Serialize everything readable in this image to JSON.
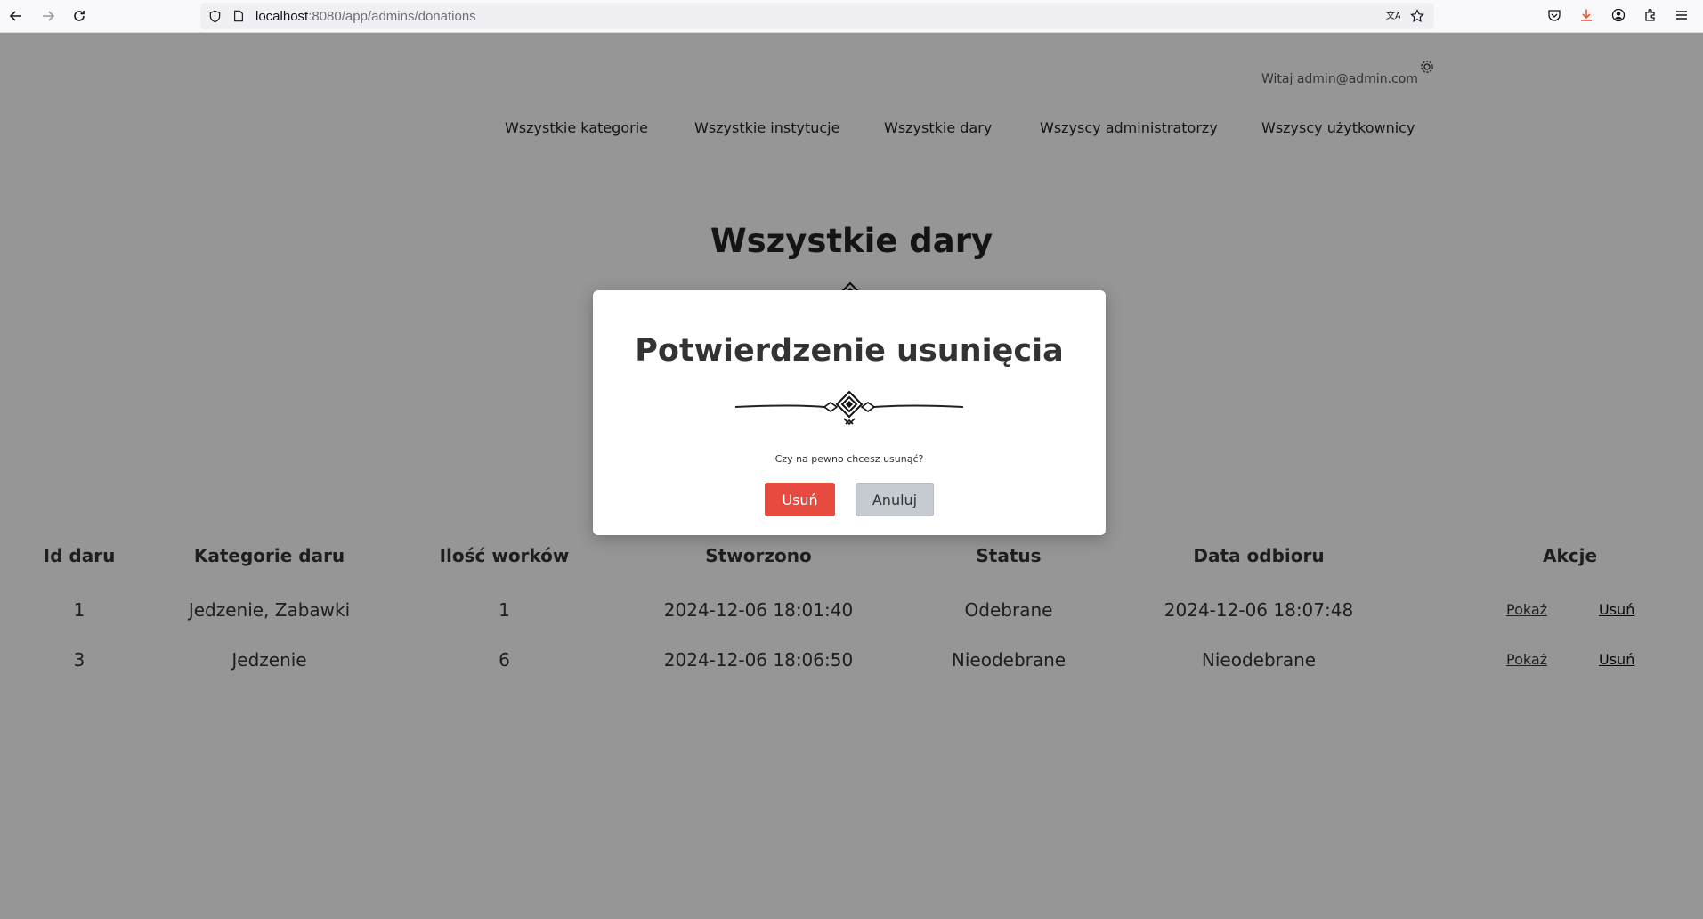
{
  "browser": {
    "url_host": "localhost",
    "url_path": ":8080/app/admins/donations"
  },
  "header": {
    "greeting": "Witaj admin@admin.com",
    "nav": [
      "Wszystkie kategorie",
      "Wszystkie instytucje",
      "Wszystkie dary",
      "Wszyscy administratorzy",
      "Wszyscy użytkownicy"
    ]
  },
  "main": {
    "title": "Wszystkie dary",
    "table": {
      "headers": [
        "Id daru",
        "Kategorie daru",
        "Ilość worków",
        "Stworzono",
        "Status",
        "Data odbioru",
        "Akcje"
      ],
      "rows": [
        {
          "id": "1",
          "categories": "Jedzenie, Zabawki",
          "bags": "1",
          "created": "2024-12-06 18:01:40",
          "status": "Odebrane",
          "pickup": "2024-12-06 18:07:48",
          "show": "Pokaż",
          "delete": "Usuń"
        },
        {
          "id": "3",
          "categories": "Jedzenie",
          "bags": "6",
          "created": "2024-12-06 18:06:50",
          "status": "Nieodebrane",
          "pickup": "Nieodebrane",
          "show": "Pokaż",
          "delete": "Usuń"
        }
      ]
    }
  },
  "modal": {
    "title": "Potwierdzenie usunięcia",
    "message": "Czy na pewno chcesz usunąć?",
    "confirm_label": "Usuń",
    "cancel_label": "Anuluj"
  },
  "colors": {
    "overlay": "#000000",
    "danger": "#e84a3f",
    "secondary": "#c5cbd1"
  }
}
